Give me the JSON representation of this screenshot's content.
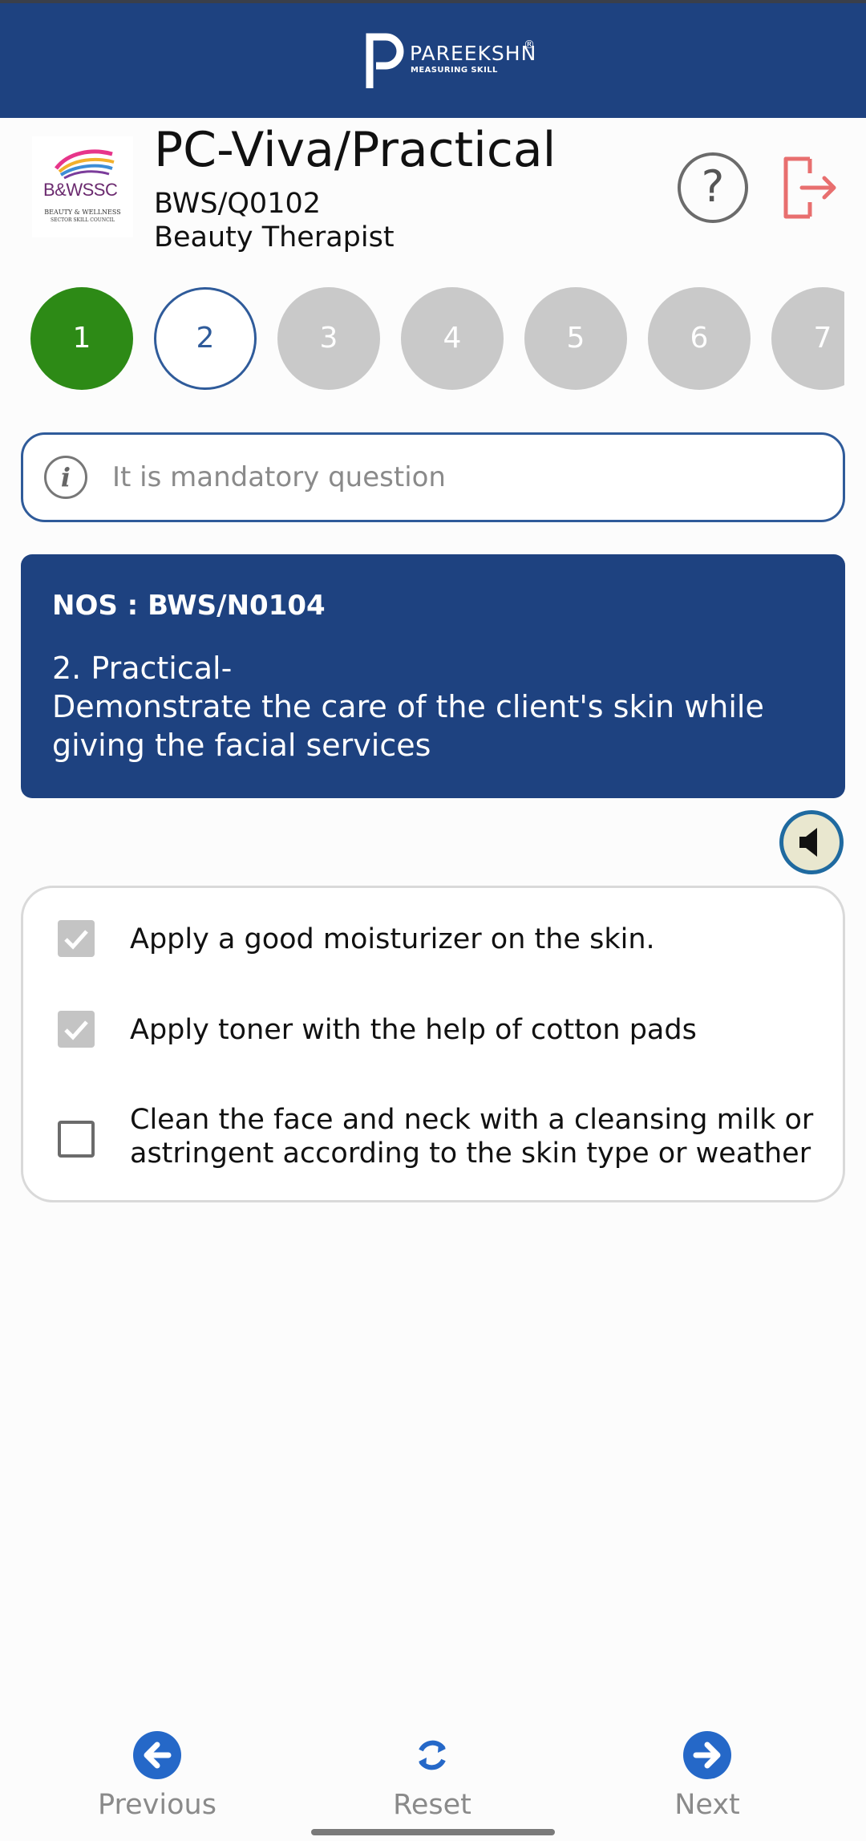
{
  "header": {
    "brand_name": "PAREEKSHN",
    "brand_registered": "®",
    "brand_tagline": "MEASURING SKILL",
    "accent_color": "#1e4280"
  },
  "logo": {
    "text": "B&WSSC",
    "line1": "BEAUTY & WELLNESS",
    "line2": "SECTOR SKILL COUNCIL"
  },
  "title": "PC-Viva/Practical",
  "qp_code": "BWS/Q0102",
  "job_role": "Beauty Therapist",
  "icons": {
    "help": "help-circle-icon",
    "logout": "logout-icon",
    "audio": "speaker-icon"
  },
  "steps": [
    {
      "label": "1",
      "state": "done"
    },
    {
      "label": "2",
      "state": "current"
    },
    {
      "label": "3",
      "state": "pending"
    },
    {
      "label": "4",
      "state": "pending"
    },
    {
      "label": "5",
      "state": "pending"
    },
    {
      "label": "6",
      "state": "pending"
    },
    {
      "label": "7",
      "state": "pending"
    }
  ],
  "notice": {
    "icon": "info-icon",
    "text": "It is mandatory question"
  },
  "question": {
    "nos": "NOS : BWS/N0104",
    "line1": "2. Practical-",
    "line2": "Demonstrate the care of the client's skin while giving the facial services"
  },
  "options": [
    {
      "label": "Apply a good moisturizer on the skin.",
      "checked": true
    },
    {
      "label": "Apply toner with the help of cotton pads",
      "checked": true
    },
    {
      "label": "Clean the face and neck with a cleansing milk or astringent according to the skin type or weather",
      "checked": false
    }
  ],
  "nav": {
    "previous": "Previous",
    "reset": "Reset",
    "next": "Next"
  }
}
